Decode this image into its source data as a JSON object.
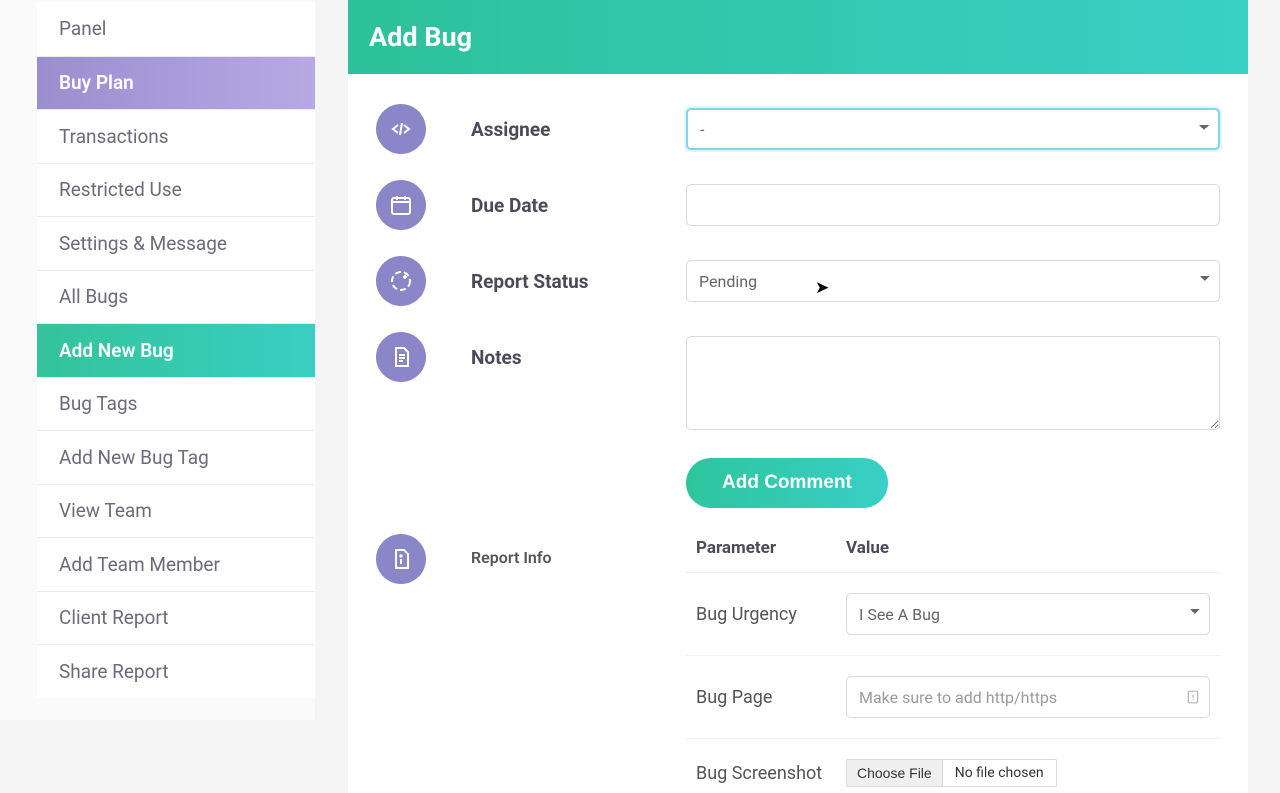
{
  "sidebar": {
    "items": [
      {
        "label": "Panel"
      },
      {
        "label": "Buy Plan"
      },
      {
        "label": "Transactions"
      },
      {
        "label": "Restricted Use"
      },
      {
        "label": "Settings & Message"
      },
      {
        "label": "All Bugs"
      },
      {
        "label": "Add New Bug"
      },
      {
        "label": "Bug Tags"
      },
      {
        "label": "Add New Bug Tag"
      },
      {
        "label": "View Team"
      },
      {
        "label": "Add Team Member"
      },
      {
        "label": "Client Report"
      },
      {
        "label": "Share Report"
      }
    ]
  },
  "page": {
    "title": "Add Bug"
  },
  "form": {
    "assignee": {
      "label": "Assignee",
      "value": "-"
    },
    "due_date": {
      "label": "Due Date",
      "value": ""
    },
    "report_status": {
      "label": "Report Status",
      "value": "Pending"
    },
    "notes": {
      "label": "Notes",
      "value": ""
    },
    "add_comment_label": "Add Comment",
    "report_info": {
      "label": "Report Info",
      "columns": {
        "parameter": "Parameter",
        "value": "Value"
      },
      "bug_urgency": {
        "label": "Bug Urgency",
        "value": "I See A Bug"
      },
      "bug_page": {
        "label": "Bug Page",
        "placeholder": "Make sure to add http/https"
      },
      "bug_screenshot": {
        "label": "Bug Screenshot",
        "choose_label": "Choose File",
        "file_state": "No file chosen"
      }
    }
  }
}
